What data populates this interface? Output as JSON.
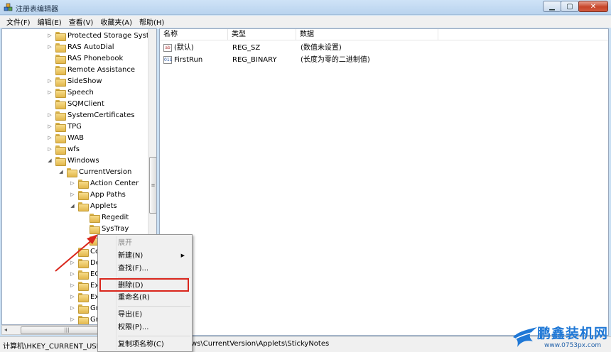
{
  "window": {
    "title": "注册表编辑器"
  },
  "menubar": [
    "文件(F)",
    "编辑(E)",
    "查看(V)",
    "收藏夹(A)",
    "帮助(H)"
  ],
  "tree": [
    {
      "label": "Protected Storage System",
      "exp": "▷",
      "depth": 0
    },
    {
      "label": "RAS AutoDial",
      "exp": "▷",
      "depth": 0
    },
    {
      "label": "RAS Phonebook",
      "exp": "",
      "depth": 0
    },
    {
      "label": "Remote Assistance",
      "exp": "",
      "depth": 0
    },
    {
      "label": "SideShow",
      "exp": "▷",
      "depth": 0
    },
    {
      "label": "Speech",
      "exp": "▷",
      "depth": 0
    },
    {
      "label": "SQMClient",
      "exp": "",
      "depth": 0
    },
    {
      "label": "SystemCertificates",
      "exp": "▷",
      "depth": 0
    },
    {
      "label": "TPG",
      "exp": "▷",
      "depth": 0
    },
    {
      "label": "WAB",
      "exp": "▷",
      "depth": 0
    },
    {
      "label": "wfs",
      "exp": "▷",
      "depth": 0
    },
    {
      "label": "Windows",
      "exp": "◢",
      "depth": 0
    },
    {
      "label": "CurrentVersion",
      "exp": "◢",
      "depth": 1
    },
    {
      "label": "Action Center",
      "exp": "▷",
      "depth": 2
    },
    {
      "label": "App Paths",
      "exp": "▷",
      "depth": 2
    },
    {
      "label": "Applets",
      "exp": "◢",
      "depth": 2
    },
    {
      "label": "Regedit",
      "exp": "",
      "depth": 3
    },
    {
      "label": "SysTray",
      "exp": "",
      "depth": 3
    },
    {
      "label": "S",
      "exp": "",
      "depth": 3,
      "selected": true
    },
    {
      "label": "Con",
      "exp": "",
      "depth": 2
    },
    {
      "label": "Dev",
      "exp": "▷",
      "depth": 2
    },
    {
      "label": "EOS",
      "exp": "▷",
      "depth": 2
    },
    {
      "label": "Expl",
      "exp": "▷",
      "depth": 2
    },
    {
      "label": "Ext",
      "exp": "▷",
      "depth": 2
    },
    {
      "label": "Gro",
      "exp": "▷",
      "depth": 2
    },
    {
      "label": "Gro",
      "exp": "▷",
      "depth": 2
    }
  ],
  "list": {
    "columns": [
      "名称",
      "类型",
      "数据"
    ],
    "rows": [
      {
        "icon": "ab",
        "name": "(默认)",
        "type": "REG_SZ",
        "data": "(数值未设置)"
      },
      {
        "icon": "011",
        "name": "FirstRun",
        "type": "REG_BINARY",
        "data": "(长度为零的二进制值)"
      }
    ]
  },
  "context_menu": {
    "items": [
      {
        "label": "展开",
        "disabled": true
      },
      {
        "label": "新建(N)",
        "submenu": true
      },
      {
        "label": "查找(F)..."
      },
      {
        "label": "删除(D)",
        "highlighted": true
      },
      {
        "label": "重命名(R)"
      },
      {
        "label": "导出(E)"
      },
      {
        "label": "权限(P)..."
      },
      {
        "label": "复制项名称(C)"
      }
    ]
  },
  "status": {
    "path_left": "计算机\\HKEY_CURRENT_USER",
    "path_right": "ws\\CurrentVersion\\Applets\\StickyNotes"
  },
  "watermark": {
    "brand": "鹏鑫装机网",
    "url": "www.0753px.com"
  },
  "colors": {
    "highlight_border": "#d9261c",
    "arrow": "#d9261c",
    "watermark": "#1f78d6"
  }
}
